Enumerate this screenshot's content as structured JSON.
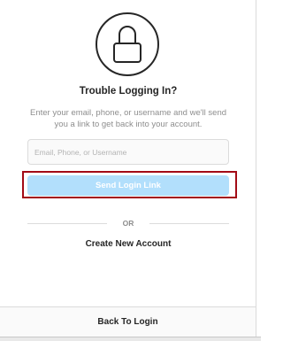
{
  "header": {
    "icon": "lock-icon",
    "title": "Trouble Logging In?",
    "description": "Enter your email, phone, or username and we'll send you a link to get back into your account."
  },
  "form": {
    "input_value": "",
    "input_placeholder": "Email, Phone, or Username",
    "send_button_label": "Send Login Link",
    "send_button_color": "#b2dffc",
    "highlight_color": "#a30b16"
  },
  "divider": {
    "label": "OR"
  },
  "links": {
    "create_account": "Create New Account",
    "back_to_login": "Back To Login"
  }
}
